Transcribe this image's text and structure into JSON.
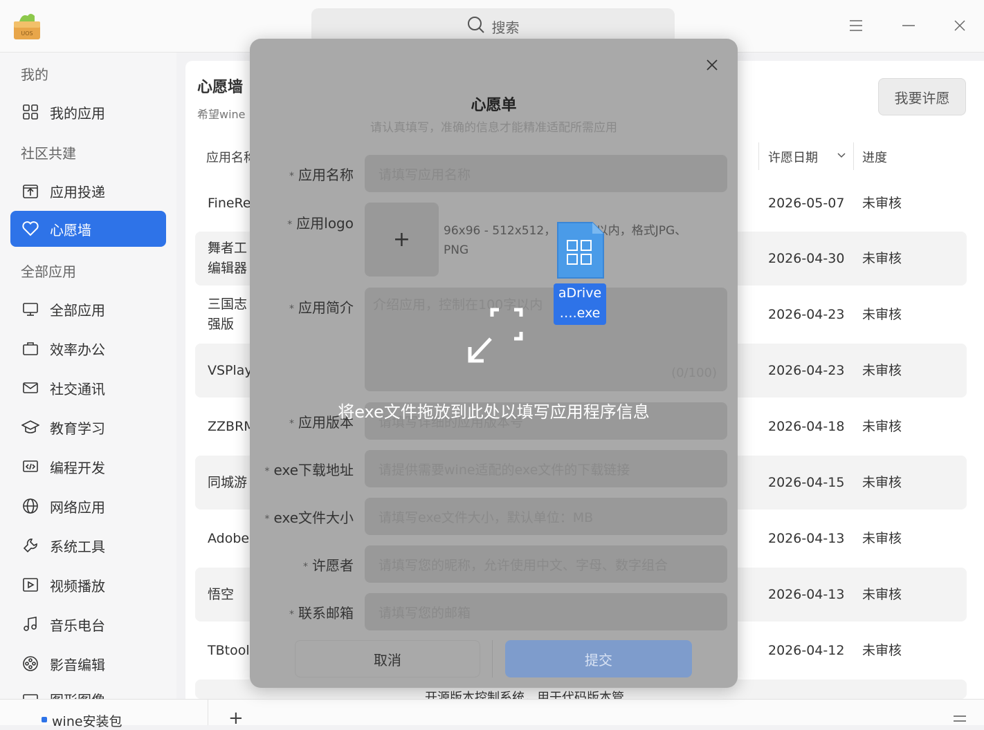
{
  "header": {
    "logo_text": "UOS",
    "search_label": "搜索"
  },
  "sidebar": {
    "sections": [
      {
        "label": "我的"
      },
      {
        "label": "社区共建"
      },
      {
        "label": "全部应用"
      }
    ],
    "items": [
      {
        "label": "我的应用",
        "icon": "grid-icon"
      },
      {
        "label": "应用投递",
        "icon": "upload-icon"
      },
      {
        "label": "心愿墙",
        "icon": "heart-icon",
        "active": true
      },
      {
        "label": "全部应用",
        "icon": "monitor-icon"
      },
      {
        "label": "效率办公",
        "icon": "briefcase-icon"
      },
      {
        "label": "社交通讯",
        "icon": "mail-icon"
      },
      {
        "label": "教育学习",
        "icon": "graduation-cap-icon"
      },
      {
        "label": "编程开发",
        "icon": "code-icon"
      },
      {
        "label": "网络应用",
        "icon": "globe-icon"
      },
      {
        "label": "系统工具",
        "icon": "tools-icon"
      },
      {
        "label": "视频播放",
        "icon": "play-icon"
      },
      {
        "label": "音乐电台",
        "icon": "music-icon"
      },
      {
        "label": "影音编辑",
        "icon": "film-reel-icon"
      },
      {
        "label": "图形图像",
        "icon": "image-icon"
      }
    ]
  },
  "main": {
    "title": "心愿墙",
    "subtitle": "希望wine",
    "wish_button": "我要许愿",
    "columns": {
      "name": "应用名称",
      "date": "许愿日期",
      "progress": "进度"
    },
    "rows": [
      {
        "name": "FineRe",
        "date": "2026-05-07",
        "status": "未审核"
      },
      {
        "name": "舞者工",
        "name2": "编辑器",
        "date": "2026-04-30",
        "status": "未审核"
      },
      {
        "name": "三国志",
        "name2": "强版",
        "date": "2026-04-23",
        "status": "未审核"
      },
      {
        "name": "VSPlay",
        "date": "2026-04-23",
        "status": "未审核"
      },
      {
        "name": "ZZBRM",
        "date": "2026-04-18",
        "status": "未审核"
      },
      {
        "name": "同城游",
        "date": "2026-04-15",
        "status": "未审核"
      },
      {
        "name": "Adobe",
        "date": "2026-04-13",
        "status": "未审核"
      },
      {
        "name": "悟空",
        "date": "2026-04-13",
        "status": "未审核"
      },
      {
        "name": "TBtool",
        "date": "2026-04-12",
        "status": "未审核"
      }
    ],
    "partial_row_text": "开源版本控制系统，用于代码版本管"
  },
  "dialog": {
    "title": "心愿单",
    "subtitle": "请认真填写，准确的信息才能精准适配所需应用",
    "fields": {
      "app_name": {
        "label": "应用名称",
        "placeholder": "请填写应用名称"
      },
      "app_logo": {
        "label": "应用logo",
        "hint": "96x96 - 512x512， 200kb以内，格式JPG、PNG"
      },
      "app_intro": {
        "label": "应用简介",
        "placeholder": "介绍应用，控制在100字以内",
        "count": "(0/100)"
      },
      "app_version": {
        "label": "应用版本",
        "placeholder": "请填写详细的应用版本号"
      },
      "exe_url": {
        "label": "exe下载地址",
        "placeholder": "请提供需要wine适配的exe文件的下载链接"
      },
      "exe_size": {
        "label": "exe文件大小",
        "placeholder": "请填写exe文件大小，默认单位：MB"
      },
      "wisher": {
        "label": "许愿者",
        "placeholder": "请填写您的昵称，允许使用中文、字母、数字组合"
      },
      "email": {
        "label": "联系邮箱",
        "placeholder": "请填写您的邮箱"
      }
    },
    "required_mark": "*",
    "cancel": "取消",
    "submit": "提交",
    "drop_message": "将exe文件拖放到此处以填写应用程序信息"
  },
  "drag_file": {
    "name_line1": "aDrive",
    "name_line2": "….exe"
  },
  "bottombar": {
    "tab_label": "wine安装包",
    "add_label": "+"
  },
  "colors": {
    "accent": "#2e73e8",
    "dialog_bg": "#a9a9a9",
    "submit_disabled": "#7e9ccc"
  }
}
